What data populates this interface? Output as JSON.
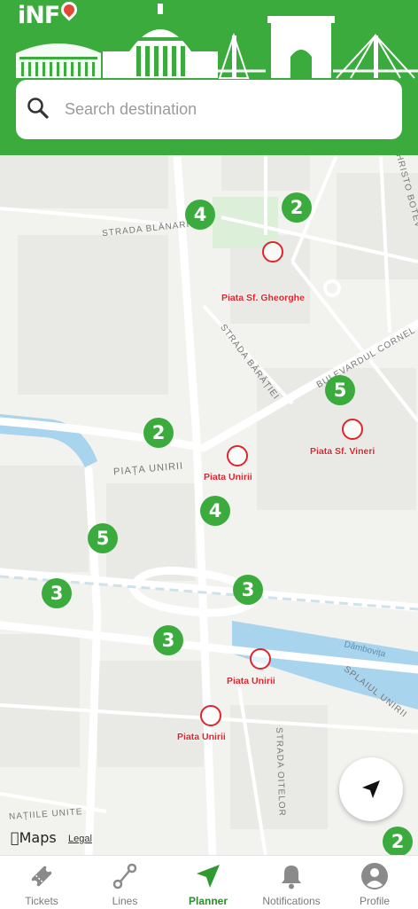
{
  "app": {
    "logo_text": "iNF"
  },
  "search": {
    "placeholder": "Search destination"
  },
  "map": {
    "streets": [
      {
        "name": "STRADA BLĂNARI"
      },
      {
        "name": "STRADA BĂRĂȚIEI"
      },
      {
        "name": "BULEVARDUL CORNEL"
      },
      {
        "name": "PIAȚA UNIRII"
      },
      {
        "name": "HRISTO BOTEV"
      },
      {
        "name": "Dâmbovița"
      },
      {
        "name": "SPLAIUL UNIRII"
      },
      {
        "name": "STRADA OITELOR"
      },
      {
        "name": "NAȚIILE UNITE"
      }
    ],
    "route_markers": [
      "4",
      "2",
      "5",
      "2",
      "4",
      "5",
      "3",
      "3",
      "3",
      "2"
    ],
    "stops": [
      "Piata Sf. Gheorghe",
      "Piata Unirii",
      "Piata Sf. Vineri",
      "Piata Unirii",
      "Piata Unirii"
    ],
    "brand": "Maps",
    "legal": "Legal"
  },
  "tabs": [
    {
      "label": "Tickets",
      "icon": "ticket-icon"
    },
    {
      "label": "Lines",
      "icon": "route-icon"
    },
    {
      "label": "Planner",
      "icon": "navigation-arrow-icon",
      "active": true
    },
    {
      "label": "Notifications",
      "icon": "bell-icon"
    },
    {
      "label": "Profile",
      "icon": "person-icon"
    }
  ],
  "colors": {
    "brand_green": "#3bab3e",
    "stop_red": "#e0242b",
    "water_blue": "#a8d4ee"
  }
}
